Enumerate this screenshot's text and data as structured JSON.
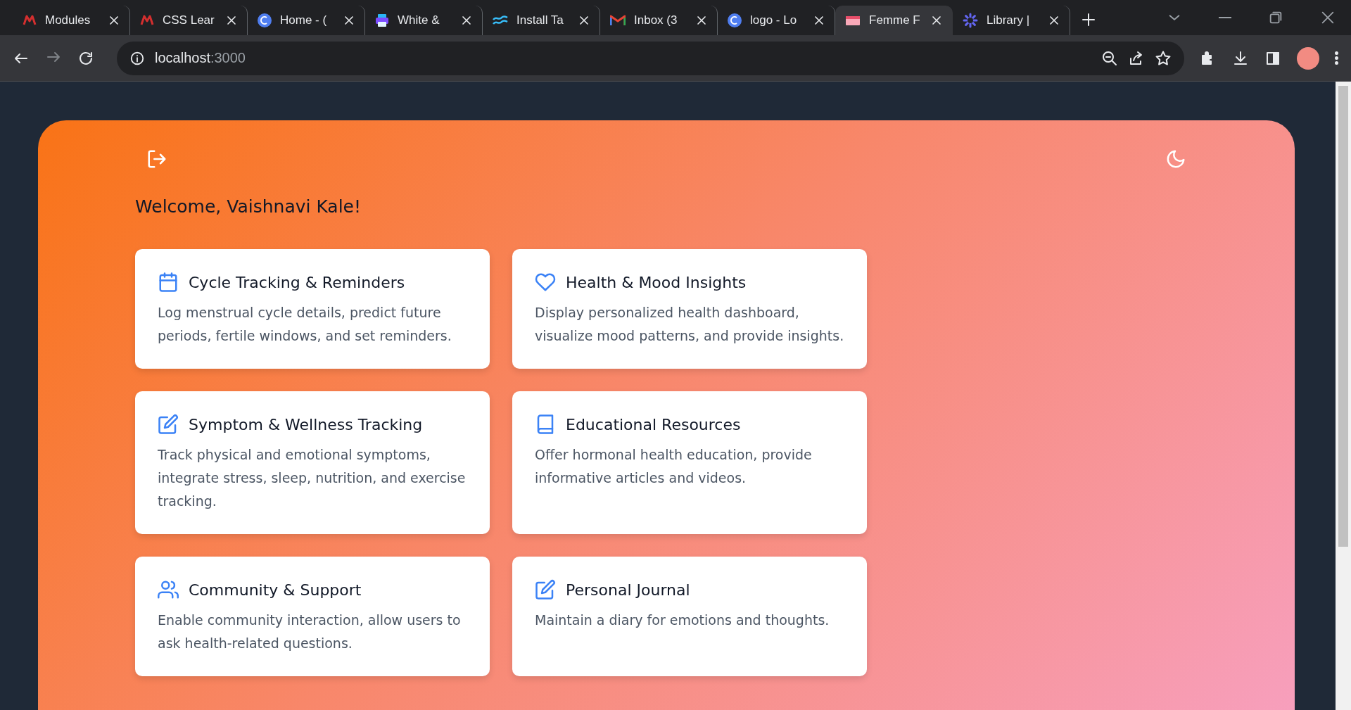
{
  "browser": {
    "tabs": [
      {
        "title": "Modules",
        "kind": "m",
        "selected": false
      },
      {
        "title": "CSS Lear",
        "kind": "m",
        "selected": false
      },
      {
        "title": "Home - (",
        "kind": "c",
        "selected": false
      },
      {
        "title": "White &",
        "kind": "printer",
        "selected": false
      },
      {
        "title": "Install Ta",
        "kind": "wave",
        "selected": false
      },
      {
        "title": "Inbox (3",
        "kind": "mail",
        "selected": false
      },
      {
        "title": "logo - Lo",
        "kind": "c",
        "selected": false
      },
      {
        "title": "Femme F",
        "kind": "card",
        "selected": true
      },
      {
        "title": "Library |",
        "kind": "flower",
        "selected": false
      }
    ],
    "address": {
      "host": "localhost",
      "port": ":3000"
    }
  },
  "page": {
    "welcome": "Welcome, Vaishnavi Kale!",
    "features": [
      {
        "kind": "calendar",
        "title": "Cycle Tracking & Reminders",
        "description": "Log menstrual cycle details, predict future periods, fertile windows, and set reminders."
      },
      {
        "kind": "heart",
        "title": "Health & Mood Insights",
        "description": "Display personalized health dashboard, visualize mood patterns, and provide insights."
      },
      {
        "kind": "edit",
        "title": "Symptom & Wellness Tracking",
        "description": "Track physical and emotional symptoms, integrate stress, sleep, nutrition, and exercise tracking."
      },
      {
        "kind": "book",
        "title": "Educational Resources",
        "description": "Offer hormonal health education, provide informative articles and videos."
      },
      {
        "kind": "users",
        "title": "Community & Support",
        "description": "Enable community interaction, allow users to ask health-related questions."
      },
      {
        "kind": "edit",
        "title": "Personal Journal",
        "description": "Maintain a diary for emotions and thoughts."
      }
    ]
  }
}
